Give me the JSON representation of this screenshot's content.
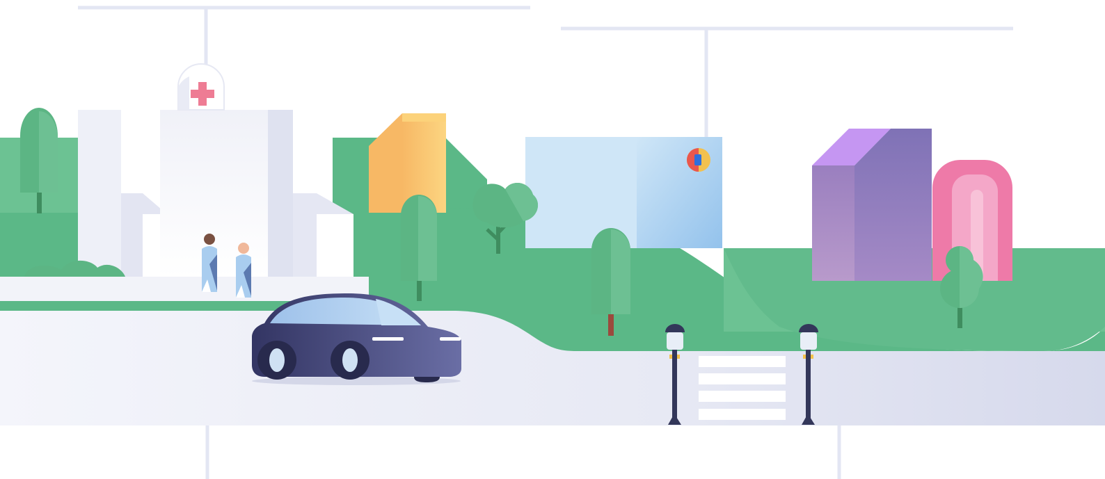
{
  "scene": {
    "description_free": true,
    "colors": {
      "background": "#ffffff",
      "connector_line": "#e3e6f3",
      "grass": "#5bb887",
      "grass_light": "#6cc293",
      "road": "#e7e9f4",
      "hospital_wall": "#eceef7",
      "hospital_shadow": "#d9dcec",
      "cross": "#ee7c94",
      "car_body": "#3d3f6e",
      "car_glass": "#a9cbef",
      "yellow_building": "#fcd27a",
      "blue_building": "#a9d0f1",
      "purple_building": "#8b7dbf",
      "purple_roof": "#c596f2",
      "pink_building": "#f08cb5",
      "tree": "#5cb584",
      "lamp_post": "#33375a",
      "crosswalk": "#ffffff"
    },
    "icons": [
      "hospital-cross-icon",
      "logo-badge-icon"
    ]
  }
}
